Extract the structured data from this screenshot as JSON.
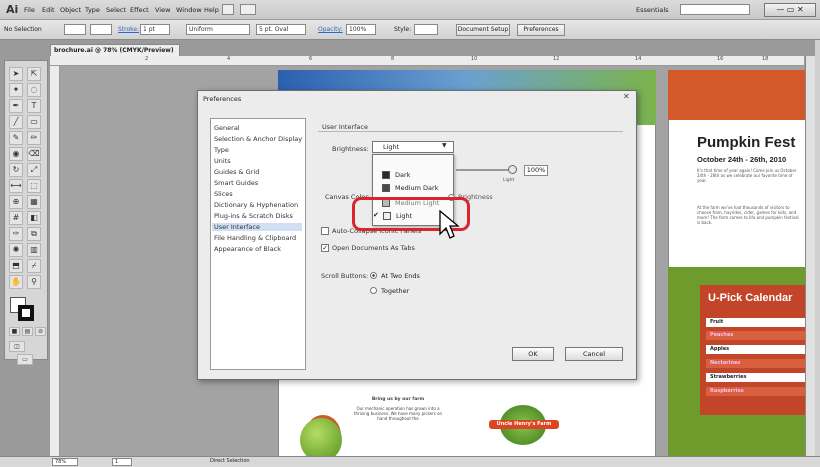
{
  "menubar": {
    "logo": "Ai",
    "items": [
      "File",
      "Edit",
      "Object",
      "Type",
      "Select",
      "Effect",
      "View",
      "Window",
      "Help"
    ],
    "workspace": "Essentials",
    "workspace_icon": "chevron-down-icon"
  },
  "control": {
    "selection": "No Selection",
    "stroke_label": "Stroke:",
    "stroke_value": "1 pt",
    "profile": "Uniform",
    "brush": "5 pt. Oval",
    "opacity_label": "Opacity:",
    "opacity_value": "100%",
    "style_label": "Style:",
    "doc_setup": "Document Setup",
    "preferences": "Preferences"
  },
  "document_tab": "brochure.ai @ 78% (CMYK/Preview)",
  "ruler_numbers": [
    "2",
    "4",
    "6",
    "8",
    "10",
    "12",
    "14",
    "16",
    "18"
  ],
  "artwork": {
    "headline": "Pumpkin Fest",
    "date": "October 24th - 26th, 2010",
    "para1": "It's that time of year again! Come join us October 24th - 26th as we celebrate our favorite time of year.",
    "para2": "At the farm we've had thousands of visitors to choose from, hayrides, cider, games for kids, and more! The farm comes to life and pumpkin festival is back.",
    "upick_title": "U-Pick Calendar",
    "rows": [
      {
        "label": "Fruit",
        "style": "header"
      },
      {
        "label": "Peaches",
        "style": "alt"
      },
      {
        "label": "Apples",
        "style": "white"
      },
      {
        "label": "Nectarines",
        "style": "alt"
      },
      {
        "label": "Strawberries",
        "style": "white"
      },
      {
        "label": "Raspberries",
        "style": "alt"
      }
    ],
    "farm_name": "Uncle Henry's Farm",
    "bottom_heading": "Bring us by our farm",
    "bottom_text": "Our mechanic operation has grown into a thriving business. We have many pickers on hand throughout the"
  },
  "dialog": {
    "title": "Preferences",
    "categories": [
      "General",
      "Selection & Anchor Display",
      "Type",
      "Units",
      "Guides & Grid",
      "Smart Guides",
      "Slices",
      "Dictionary & Hyphenation",
      "Plug-ins & Scratch Disks",
      "User Interface",
      "File Handling & Clipboard",
      "Appearance of Black"
    ],
    "selected_category": "User Interface",
    "panel_title": "User Interface",
    "brightness_label": "Brightness:",
    "brightness_value": "Light",
    "dropdown_options": [
      {
        "label": "Dark",
        "swatch": "#2b2b2b",
        "checked": false
      },
      {
        "label": "Medium Dark",
        "swatch": "#4a4a4a",
        "checked": false
      },
      {
        "label": "Medium Light",
        "swatch": "#b8b8b8",
        "checked": false
      },
      {
        "label": "Light",
        "swatch": "#eeeeee",
        "checked": true
      }
    ],
    "slider_value": "100%",
    "slider_sublabel": "Light",
    "canvas_color_label": "Canvas Color:",
    "brightness_sub": "Brightness",
    "auto_collapse_label": "Auto-Collapse Iconic Panels",
    "auto_collapse_checked": false,
    "open_docs_label": "Open Documents As Tabs",
    "open_docs_checked": true,
    "scroll_label": "Scroll Buttons:",
    "scroll_options": [
      {
        "label": "At Two Ends",
        "selected": true
      },
      {
        "label": "Together",
        "selected": false
      }
    ],
    "ok": "OK",
    "cancel": "Cancel"
  },
  "status": {
    "zoom": "78%",
    "page": "1",
    "tool": "Direct Selection"
  },
  "colors": {
    "highlight": "#d8262b",
    "orange": "#d3582a",
    "red_panel": "#c2452a",
    "green": "#6f9a2c"
  }
}
